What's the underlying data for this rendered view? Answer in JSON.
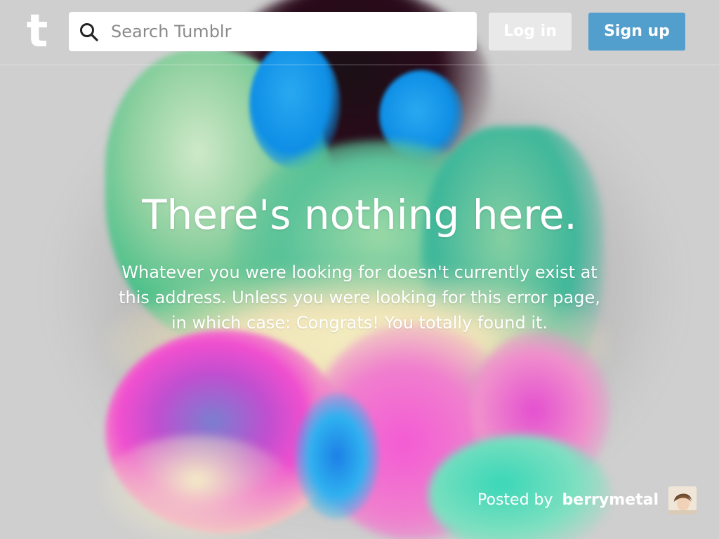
{
  "header": {
    "logo_letter": "t",
    "search": {
      "placeholder": "Search Tumblr",
      "value": "",
      "icon": "search-icon"
    },
    "login_label": "Log in",
    "signup_label": "Sign up"
  },
  "message": {
    "title": "There's nothing here.",
    "body": "Whatever you were looking for doesn't currently exist at this address. Unless you were looking for this error page, in which case: Congrats! You totally found it."
  },
  "credit": {
    "prefix": "Posted by",
    "username": "berrymetal",
    "avatar_icon": "user-avatar"
  },
  "colors": {
    "signup_button": "#529ecc",
    "login_button": "#ebebeb",
    "background": "#cfcfcf",
    "text": "#ffffff"
  }
}
